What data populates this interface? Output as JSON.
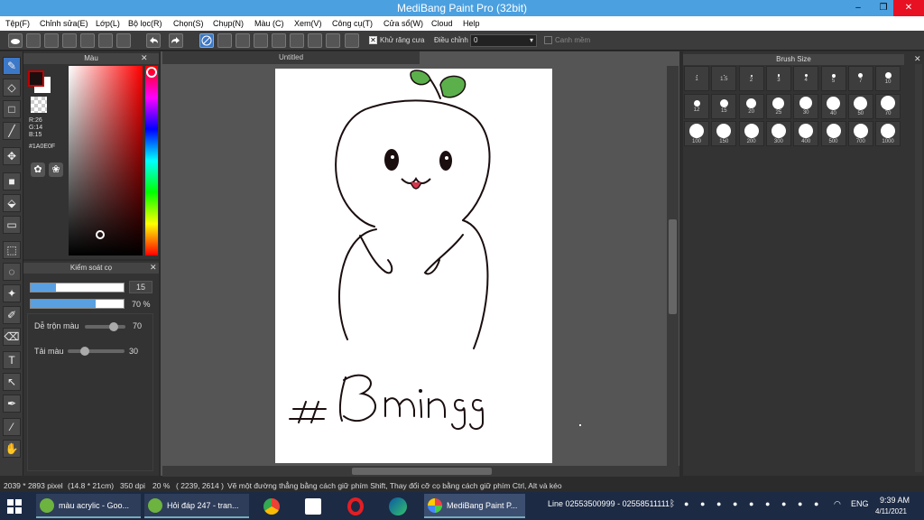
{
  "window": {
    "title": "MediBang Paint Pro (32bit)",
    "min": "–",
    "restore": "❐",
    "close": "✕"
  },
  "menu": [
    "Tệp(F)",
    "Chỉnh sửa(E)",
    "Lớp(L)",
    "Bộ lọc(R)",
    "Chọn(S)",
    "Chụp(N)",
    "Màu (C)",
    "Xem(V)",
    "Công cụ(T)",
    "Cửa sổ(W)",
    "Cloud",
    "Help"
  ],
  "toolbar": {
    "antialias_label": "Khử răng cưa",
    "adjust_label": "Điều chỉnh",
    "adjust_value": "0",
    "edge_label": "Canh mềm"
  },
  "color_panel": {
    "title": "Màu",
    "r": "R:26",
    "g": "G:14",
    "b": "B:15",
    "hex": "#1A0E0F",
    "fg": "#1A0E0F",
    "bg": "#ffffff",
    "primary_swatch": "#c00000"
  },
  "brush_control": {
    "title": "Kiểm soát cọ",
    "size_value": "15",
    "opacity_value": "70 %",
    "size_frac": 0.27,
    "opacity_frac": 0.7,
    "mix_label": "Dễ trộn màu",
    "mix_value": "70",
    "mix_frac": 0.7,
    "load_label": "Tải màu",
    "load_value": "30",
    "load_frac": 0.3
  },
  "canvas": {
    "tab": "Untitled",
    "text": "#Bmingg"
  },
  "brush_size": {
    "title": "Brush Size",
    "sizes": [
      "1",
      "1.5",
      "2",
      "3",
      "4",
      "5",
      "7",
      "10",
      "12",
      "15",
      "20",
      "25",
      "30",
      "40",
      "50",
      "70",
      "100",
      "150",
      "200",
      "300",
      "400",
      "500",
      "700",
      "1000"
    ]
  },
  "status": {
    "dims": "2039 * 2893 pixel",
    "cm": "(14.8 * 21cm)",
    "dpi": "350 dpi",
    "zoom": "20 %",
    "coords": "( 2239, 2614 )",
    "hint": "Vẽ một đường thẳng bằng cách giữ phím Shift, Thay đổi cỡ cọ bằng cách giữ phím Ctrl, Alt và kéo"
  },
  "taskbar": {
    "apps": [
      {
        "label": "màu acrylic - Goo..."
      },
      {
        "label": "Hỏi đáp 247 - tran..."
      },
      {
        "label": "MediBang Paint P..."
      }
    ],
    "line_text": "Line 02553500999 - 02558511111",
    "lang": "ENG",
    "time": "9:39 AM",
    "date": "4/11/2021"
  }
}
